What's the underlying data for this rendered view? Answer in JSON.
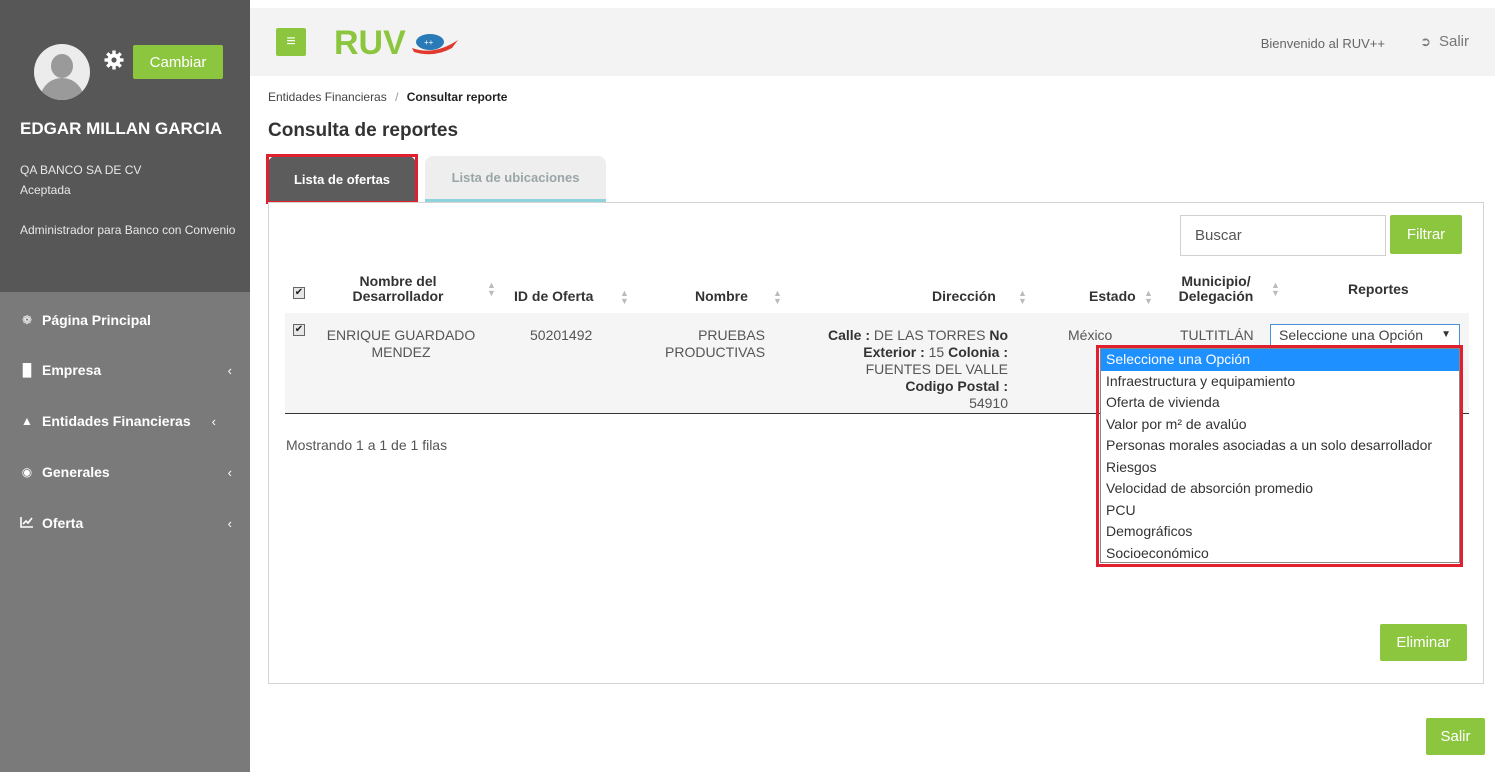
{
  "profile": {
    "change_button": "Cambiar",
    "name": "EDGAR MILLAN GARCIA",
    "company": "QA BANCO SA DE CV",
    "status": "Aceptada",
    "role": "Administrador para Banco con Convenio"
  },
  "nav": {
    "items": [
      {
        "label": "Página Principal",
        "icon": "home-icon"
      },
      {
        "label": "Empresa",
        "icon": "building-icon"
      },
      {
        "label": "Entidades Financieras",
        "icon": "bank-icon"
      },
      {
        "label": "Generales",
        "icon": "dashboard-icon"
      },
      {
        "label": "Oferta",
        "icon": "chart-icon"
      }
    ]
  },
  "topbar": {
    "logo_text": "RUV",
    "welcome": "Bienvenido al RUV++",
    "logout": "Salir"
  },
  "breadcrumb": {
    "parent": "Entidades Financieras",
    "separator": "/",
    "current": "Consultar reporte"
  },
  "page": {
    "title": "Consulta de reportes"
  },
  "tabs": [
    {
      "label": "Lista de ofertas",
      "active": true
    },
    {
      "label": "Lista de ubicaciones",
      "active": false
    }
  ],
  "toolbar": {
    "search_placeholder": "Buscar",
    "filter_button": "Filtrar"
  },
  "table": {
    "headers": {
      "developer": "Nombre del Desarrollador",
      "offer_id": "ID de Oferta",
      "name": "Nombre",
      "address": "Dirección",
      "state": "Estado",
      "municipality": "Municipio/ Delegación",
      "reports": "Reportes"
    },
    "rows": [
      {
        "checked": true,
        "developer": "ENRIQUE GUARDADO MENDEZ",
        "offer_id": "50201492",
        "name": "PRUEBAS PRODUCTIVAS",
        "address": {
          "calle_label": "Calle :",
          "calle": "DE LAS TORRES",
          "no_label": "No",
          "exterior_label": "Exterior :",
          "exterior": "15",
          "colonia_label": "Colonia :",
          "colonia": "FUENTES DEL VALLE",
          "cp_label": "Codigo Postal :",
          "cp": "54910"
        },
        "state": "México",
        "municipality": "TULTITLÁN",
        "report_select": "Seleccione una Opción"
      }
    ],
    "summary": "Mostrando 1 a 1 de 1 filas"
  },
  "report_options": [
    "Seleccione una Opción",
    "Infraestructura y equipamiento",
    "Oferta de vivienda",
    "Valor por m² de avalúo",
    "Personas morales asociadas a un solo desarrollador",
    "Riesgos",
    "Velocidad de absorción promedio",
    "PCU",
    "Demográficos",
    "Socioeconómico"
  ],
  "actions": {
    "delete_button": "Eliminar",
    "exit_button": "Salir"
  },
  "colors": {
    "accent_green": "#8cc63f",
    "sidebar_dark": "#575757",
    "sidebar": "#7a7a7a",
    "highlight_red": "#e0202e",
    "option_selected": "#1e90ff"
  }
}
